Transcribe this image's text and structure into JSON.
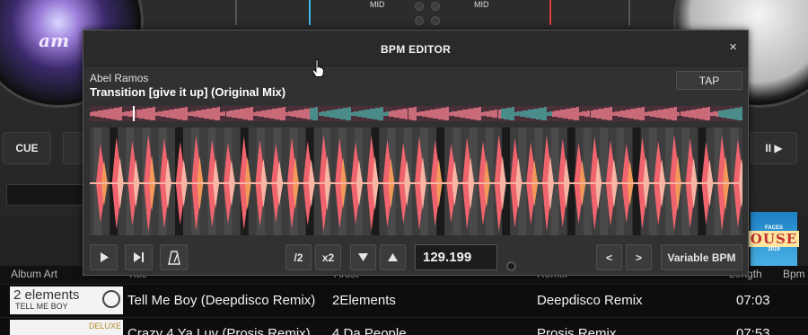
{
  "background": {
    "left_platter_art_text": "am",
    "mixer_labels": [
      "MID",
      "MID"
    ],
    "cue_label": "CUE",
    "play_pause_label": "II ▶",
    "right_album_art": {
      "top": "FACES",
      "main": "OUSE",
      "year": "2019"
    }
  },
  "browser": {
    "columns": [
      "Album Art",
      "Title",
      "Artist",
      "Remix",
      "Length",
      "Bpm"
    ],
    "rows": [
      {
        "art_title": "2 elements",
        "art_subtitle": "TELL ME BOY",
        "title": "Tell Me Boy (Deepdisco Remix)",
        "artist": "2Elements",
        "remix": "Deepdisco Remix",
        "length": "07:03"
      },
      {
        "art_title": "",
        "art_subtitle": "DELUXE",
        "title": "Crazy 4 Ya Luv (Prosis Remix)",
        "artist": "4 Da People",
        "remix": "Prosis Remix",
        "length": "07:53"
      }
    ]
  },
  "bpm_editor": {
    "title": "BPM EDITOR",
    "close_glyph": "×",
    "artist": "Abel Ramos",
    "track_title": "Transition [give it up] (Original Mix)",
    "tap_label": "TAP",
    "controls": {
      "play_icon": "play-icon",
      "play_label": "▶",
      "skip_end_label": "▶|",
      "metronome_icon": "metronome-icon",
      "half_label": "/2",
      "double_label": "x2",
      "down_label": "▼",
      "up_label": "▲",
      "bpm_value": "129.199",
      "prev_label": "<",
      "next_label": ">",
      "variable_bpm_label": "Variable BPM"
    },
    "colors": {
      "waveform_pink": "#f0646e",
      "waveform_peach": "#f7b6a3",
      "waveform_orange": "#f39a5b",
      "overview_bg": "#4b2f38"
    }
  }
}
